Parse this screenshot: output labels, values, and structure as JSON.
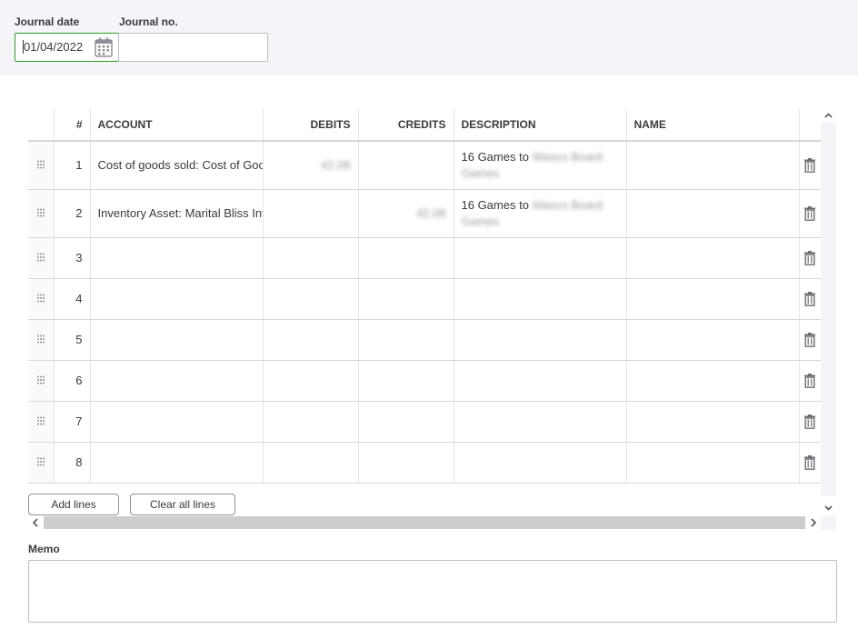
{
  "header": {
    "journal_date_label": "Journal date",
    "journal_date_value": "01/04/2022",
    "journal_no_label": "Journal no.",
    "journal_no_value": ""
  },
  "grid": {
    "columns": [
      "#",
      "ACCOUNT",
      "DEBITS",
      "CREDITS",
      "DESCRIPTION",
      "NAME"
    ],
    "rows": [
      {
        "num": "1",
        "account": "Cost of goods sold: Cost of Goods Sold",
        "debit": "42.08",
        "credit": "",
        "desc_visible": "16 Games to",
        "desc_blurred": "Wasco Board Games",
        "name": ""
      },
      {
        "num": "2",
        "account": "Inventory Asset: Marital Bliss Inventory",
        "debit": "",
        "credit": "42.08",
        "desc_visible": "16 Games to",
        "desc_blurred": "Wasco Board Games",
        "name": ""
      },
      {
        "num": "3",
        "account": "",
        "debit": "",
        "credit": "",
        "desc_visible": "",
        "desc_blurred": "",
        "name": ""
      },
      {
        "num": "4",
        "account": "",
        "debit": "",
        "credit": "",
        "desc_visible": "",
        "desc_blurred": "",
        "name": ""
      },
      {
        "num": "5",
        "account": "",
        "debit": "",
        "credit": "",
        "desc_visible": "",
        "desc_blurred": "",
        "name": ""
      },
      {
        "num": "6",
        "account": "",
        "debit": "",
        "credit": "",
        "desc_visible": "",
        "desc_blurred": "",
        "name": ""
      },
      {
        "num": "7",
        "account": "",
        "debit": "",
        "credit": "",
        "desc_visible": "",
        "desc_blurred": "",
        "name": ""
      },
      {
        "num": "8",
        "account": "",
        "debit": "",
        "credit": "",
        "desc_visible": "",
        "desc_blurred": "",
        "name": ""
      }
    ]
  },
  "buttons": {
    "add_lines": "Add lines",
    "clear_all_lines": "Clear all lines"
  },
  "memo": {
    "label": "Memo",
    "value": ""
  },
  "icons": {
    "calendar": "calendar-icon",
    "drag": "drag-handle-icon",
    "trash": "trash-icon"
  },
  "colors": {
    "accent_green": "#2ca01c",
    "header_bg": "#f4f5f8"
  }
}
